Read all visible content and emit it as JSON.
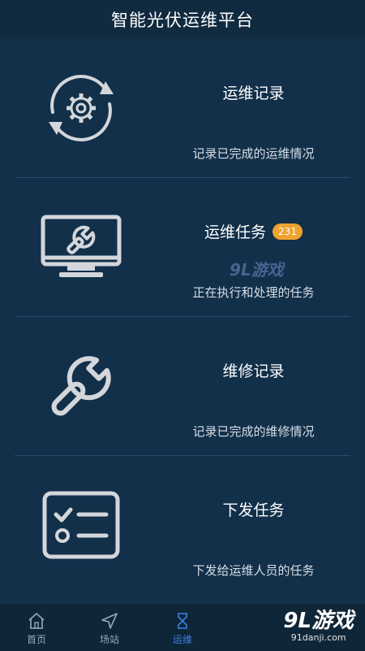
{
  "header": {
    "title": "智能光伏运维平台"
  },
  "cards": [
    {
      "icon": "gear-cycle-icon",
      "title": "运维记录",
      "subtitle": "记录已完成的运维情况"
    },
    {
      "icon": "monitor-wrench-icon",
      "title": "运维任务",
      "badge": "231",
      "subtitle": "正在执行和处理的任务"
    },
    {
      "icon": "wrench-icon",
      "title": "维修记录",
      "subtitle": "记录已完成的维修情况"
    },
    {
      "icon": "checklist-icon",
      "title": "下发任务",
      "subtitle": "下发给运维人员的任务"
    }
  ],
  "bottom_nav": [
    {
      "icon": "home-icon",
      "label": "首页",
      "active": false
    },
    {
      "icon": "send-icon",
      "label": "场站",
      "active": false
    },
    {
      "icon": "hourglass-icon",
      "label": "运维",
      "active": true
    }
  ],
  "watermark": {
    "main": "9L游戏",
    "sub": "91danji.com"
  },
  "colors": {
    "background": "#12304a",
    "topbar": "#102a40",
    "badge": "#f0a230",
    "active": "#3d7fe0"
  }
}
